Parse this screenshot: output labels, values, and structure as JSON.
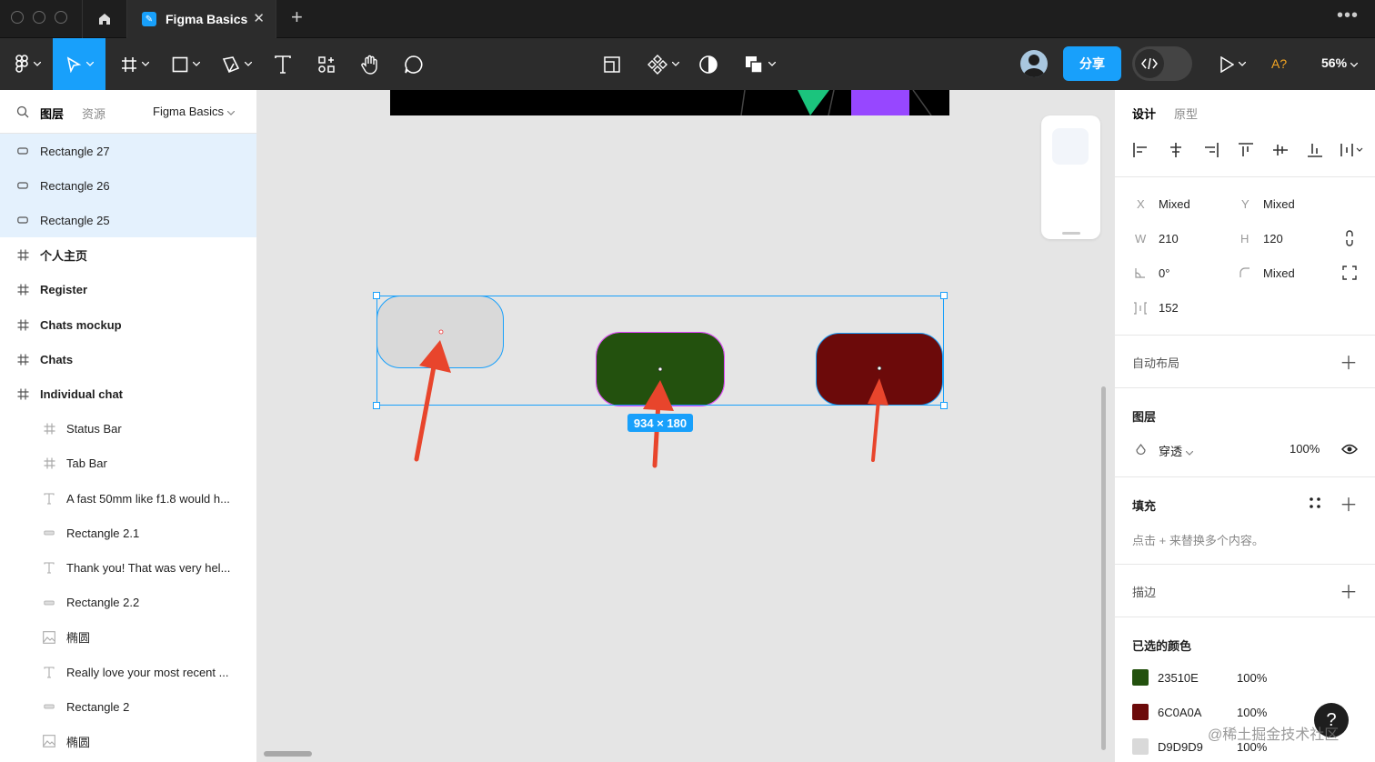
{
  "window": {
    "file_tab_title": "Figma Basics",
    "new_tab_symbol": "+",
    "close_symbol": "✕",
    "more_symbol": "•••"
  },
  "toolbar": {
    "share_label": "分享",
    "missing_fonts_label": "A?",
    "zoom_label": "56%"
  },
  "left_panel": {
    "tabs": [
      "图层",
      "资源"
    ],
    "page_name": "Figma Basics",
    "layers": [
      {
        "name": "Rectangle 27",
        "icon": "rectangle-icon",
        "selected": true,
        "type": "rect"
      },
      {
        "name": "Rectangle 26",
        "icon": "rectangle-icon",
        "selected": true,
        "type": "rect"
      },
      {
        "name": "Rectangle 25",
        "icon": "rectangle-icon",
        "selected": true,
        "type": "rect"
      },
      {
        "name": "个人主页",
        "icon": "frame-icon",
        "type": "frame"
      },
      {
        "name": "Register",
        "icon": "frame-icon",
        "type": "frame"
      },
      {
        "name": "Chats mockup",
        "icon": "frame-icon",
        "type": "frame"
      },
      {
        "name": "Chats",
        "icon": "frame-icon",
        "type": "frame"
      },
      {
        "name": "Individual chat",
        "icon": "frame-icon",
        "type": "frame"
      },
      {
        "name": "Status Bar",
        "icon": "frame-icon",
        "type": "child"
      },
      {
        "name": "Tab Bar",
        "icon": "frame-icon",
        "type": "child"
      },
      {
        "name": "A fast 50mm like f1.8 would h...",
        "icon": "text-icon",
        "type": "child"
      },
      {
        "name": "Rectangle 2.1",
        "icon": "rectangle-icon",
        "type": "child"
      },
      {
        "name": "Thank you! That was very hel...",
        "icon": "text-icon",
        "type": "child"
      },
      {
        "name": "Rectangle 2.2",
        "icon": "rectangle-icon",
        "type": "child"
      },
      {
        "name": "椭圆",
        "icon": "image-icon",
        "type": "child"
      },
      {
        "name": "Really love your most recent ...",
        "icon": "text-icon",
        "type": "child"
      },
      {
        "name": "Rectangle 2",
        "icon": "rectangle-icon",
        "type": "child"
      },
      {
        "name": "椭圆",
        "icon": "image-icon",
        "type": "child"
      }
    ]
  },
  "canvas": {
    "dimension_label": "934 × 180",
    "shapes": [
      {
        "name": "Rectangle 27",
        "color": "#D9D9D9"
      },
      {
        "name": "Rectangle 26",
        "color": "#23510E"
      },
      {
        "name": "Rectangle 25",
        "color": "#6C0A0A"
      }
    ]
  },
  "right_panel": {
    "tabs": [
      "设计",
      "原型"
    ],
    "x_label": "X",
    "x_value": "Mixed",
    "y_label": "Y",
    "y_value": "Mixed",
    "w_label": "W",
    "w_value": "210",
    "h_label": "H",
    "h_value": "120",
    "rotation_value": "0°",
    "radius_value": "Mixed",
    "spacing_value": "152",
    "auto_layout_title": "自动布局",
    "layer_title": "图层",
    "blend_mode": "穿透",
    "opacity": "100%",
    "fill_title": "填充",
    "fill_hint": "点击 + 来替换多个内容。",
    "stroke_title": "描边",
    "selected_colors_title": "已选的颜色",
    "selected_colors": [
      {
        "hex": "23510E",
        "opacity": "100%",
        "color": "#23510E"
      },
      {
        "hex": "6C0A0A",
        "opacity": "100%",
        "color": "#6C0A0A"
      },
      {
        "hex": "D9D9D9",
        "opacity": "100%",
        "color": "#D9D9D9"
      }
    ]
  },
  "help_label": "?",
  "watermark": "@稀土掘金技术社区"
}
